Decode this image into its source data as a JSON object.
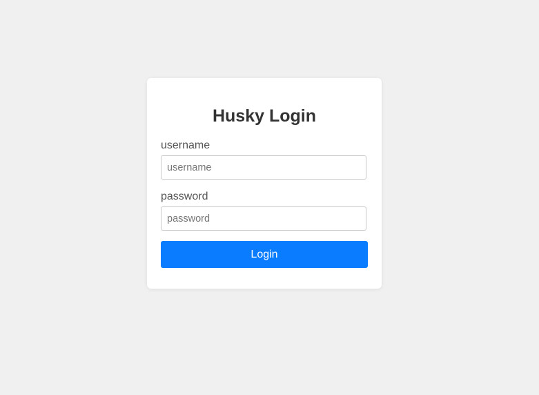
{
  "login": {
    "title": "Husky Login",
    "username_label": "username",
    "username_placeholder": "username",
    "username_value": "",
    "password_label": "password",
    "password_placeholder": "password",
    "password_value": "",
    "button_label": "Login"
  },
  "colors": {
    "background": "#f0f0f0",
    "card": "#ffffff",
    "accent": "#0a7cff",
    "title_text": "#333333"
  }
}
